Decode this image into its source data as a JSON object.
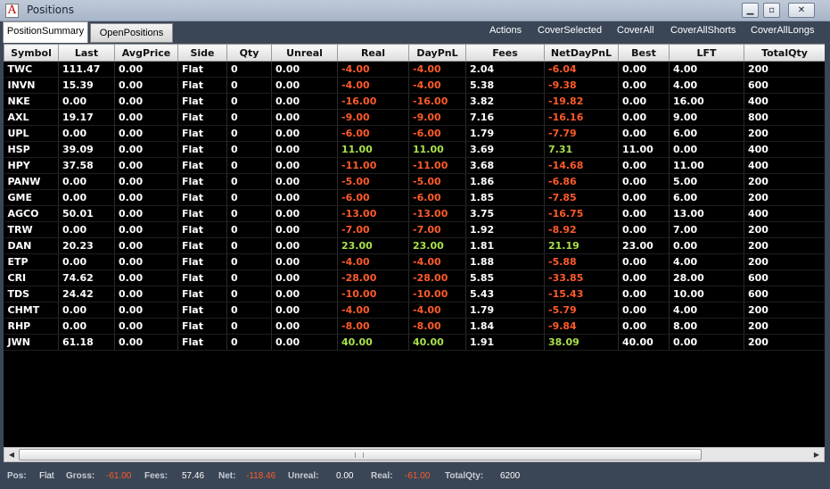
{
  "window": {
    "title": "Positions",
    "app_icon": "A"
  },
  "tabs": [
    {
      "label": "PositionSummary",
      "active": true
    },
    {
      "label": "OpenPositions",
      "active": false
    }
  ],
  "actions": [
    "Actions",
    "CoverSelected",
    "CoverAll",
    "CoverAllShorts",
    "CoverAllLongs"
  ],
  "table": {
    "columns": [
      "Symbol",
      "Last",
      "AvgPrice",
      "Side",
      "Qty",
      "Unreal",
      "Real",
      "DayPnL",
      "Fees",
      "NetDayPnL",
      "Best",
      "LFT",
      "TotalQty"
    ],
    "rows": [
      [
        "TWC",
        "111.47",
        "0.00",
        "Flat",
        "0",
        "0.00",
        "-4.00",
        "-4.00",
        "2.04",
        "-6.04",
        "0.00",
        "4.00",
        "200"
      ],
      [
        "INVN",
        "15.39",
        "0.00",
        "Flat",
        "0",
        "0.00",
        "-4.00",
        "-4.00",
        "5.38",
        "-9.38",
        "0.00",
        "4.00",
        "600"
      ],
      [
        "NKE",
        "0.00",
        "0.00",
        "Flat",
        "0",
        "0.00",
        "-16.00",
        "-16.00",
        "3.82",
        "-19.82",
        "0.00",
        "16.00",
        "400"
      ],
      [
        "AXL",
        "19.17",
        "0.00",
        "Flat",
        "0",
        "0.00",
        "-9.00",
        "-9.00",
        "7.16",
        "-16.16",
        "0.00",
        "9.00",
        "800"
      ],
      [
        "UPL",
        "0.00",
        "0.00",
        "Flat",
        "0",
        "0.00",
        "-6.00",
        "-6.00",
        "1.79",
        "-7.79",
        "0.00",
        "6.00",
        "200"
      ],
      [
        "HSP",
        "39.09",
        "0.00",
        "Flat",
        "0",
        "0.00",
        "11.00",
        "11.00",
        "3.69",
        "7.31",
        "11.00",
        "0.00",
        "400"
      ],
      [
        "HPY",
        "37.58",
        "0.00",
        "Flat",
        "0",
        "0.00",
        "-11.00",
        "-11.00",
        "3.68",
        "-14.68",
        "0.00",
        "11.00",
        "400"
      ],
      [
        "PANW",
        "0.00",
        "0.00",
        "Flat",
        "0",
        "0.00",
        "-5.00",
        "-5.00",
        "1.86",
        "-6.86",
        "0.00",
        "5.00",
        "200"
      ],
      [
        "GME",
        "0.00",
        "0.00",
        "Flat",
        "0",
        "0.00",
        "-6.00",
        "-6.00",
        "1.85",
        "-7.85",
        "0.00",
        "6.00",
        "200"
      ],
      [
        "AGCO",
        "50.01",
        "0.00",
        "Flat",
        "0",
        "0.00",
        "-13.00",
        "-13.00",
        "3.75",
        "-16.75",
        "0.00",
        "13.00",
        "400"
      ],
      [
        "TRW",
        "0.00",
        "0.00",
        "Flat",
        "0",
        "0.00",
        "-7.00",
        "-7.00",
        "1.92",
        "-8.92",
        "0.00",
        "7.00",
        "200"
      ],
      [
        "DAN",
        "20.23",
        "0.00",
        "Flat",
        "0",
        "0.00",
        "23.00",
        "23.00",
        "1.81",
        "21.19",
        "23.00",
        "0.00",
        "200"
      ],
      [
        "ETP",
        "0.00",
        "0.00",
        "Flat",
        "0",
        "0.00",
        "-4.00",
        "-4.00",
        "1.88",
        "-5.88",
        "0.00",
        "4.00",
        "200"
      ],
      [
        "CRI",
        "74.62",
        "0.00",
        "Flat",
        "0",
        "0.00",
        "-28.00",
        "-28.00",
        "5.85",
        "-33.85",
        "0.00",
        "28.00",
        "600"
      ],
      [
        "TDS",
        "24.42",
        "0.00",
        "Flat",
        "0",
        "0.00",
        "-10.00",
        "-10.00",
        "5.43",
        "-15.43",
        "0.00",
        "10.00",
        "600"
      ],
      [
        "CHMT",
        "0.00",
        "0.00",
        "Flat",
        "0",
        "0.00",
        "-4.00",
        "-4.00",
        "1.79",
        "-5.79",
        "0.00",
        "4.00",
        "200"
      ],
      [
        "RHP",
        "0.00",
        "0.00",
        "Flat",
        "0",
        "0.00",
        "-8.00",
        "-8.00",
        "1.84",
        "-9.84",
        "0.00",
        "8.00",
        "200"
      ],
      [
        "JWN",
        "61.18",
        "0.00",
        "Flat",
        "0",
        "0.00",
        "40.00",
        "40.00",
        "1.91",
        "38.09",
        "40.00",
        "0.00",
        "200"
      ]
    ]
  },
  "status": [
    {
      "label": "Pos:",
      "value": "Flat"
    },
    {
      "label": "Gross:",
      "value": "-61.00"
    },
    {
      "label": "Fees:",
      "value": "57.46"
    },
    {
      "label": "Net:",
      "value": "-118.46"
    },
    {
      "label": "Unreal:",
      "value": "0.00"
    },
    {
      "label": "Real:",
      "value": "-61.00"
    },
    {
      "label": "TotalQty:",
      "value": "6200"
    }
  ],
  "colors": {
    "negative": "#ff5a2a",
    "positive": "#a8e04a",
    "grid_bg": "#000000",
    "chrome_bg": "#3a4656"
  },
  "icons": {
    "minimize": "minimize-icon",
    "maximize": "maximize-icon",
    "close": "close-icon",
    "scroll_left": "arrow-left-icon",
    "scroll_right": "arrow-right-icon"
  }
}
